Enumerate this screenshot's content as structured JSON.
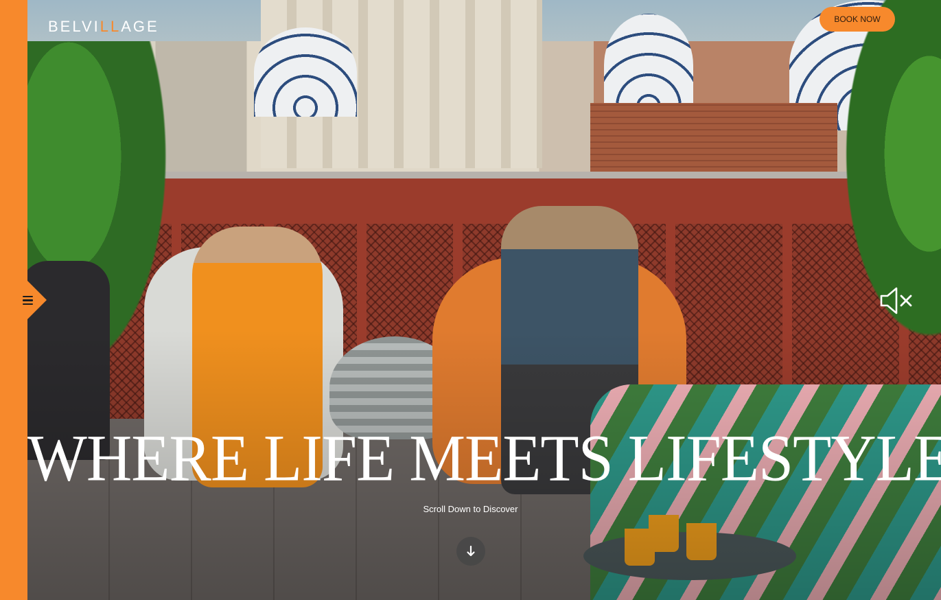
{
  "brand": {
    "logo_pre": "BELVI",
    "logo_mark": "LL",
    "logo_post": "AGE",
    "accent_color": "#f7892c"
  },
  "header": {
    "book_now_label": "BOOK NOW"
  },
  "hero": {
    "headline": "WHERE LIFE MEETS LIFESTYLE",
    "scroll_text": "Scroll Down to Discover"
  },
  "icons": {
    "menu": "hamburger-menu-icon",
    "mute": "speaker-muted-icon",
    "scroll": "arrow-down-icon"
  }
}
